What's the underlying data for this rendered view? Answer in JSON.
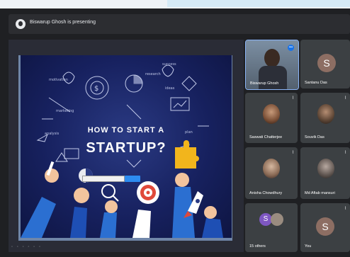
{
  "meeting": {
    "presenting_text": "Biswarup Ghosh is presenting"
  },
  "slide": {
    "title_line1": "HOW TO START A",
    "title_line2": "STARTUP?",
    "input_text": "",
    "button_text": ""
  },
  "participants": [
    {
      "name": "Biswarup Ghosh",
      "type": "video"
    },
    {
      "name": "Santanu Das",
      "type": "avatar",
      "initial": "S",
      "color": "#8d6e63"
    },
    {
      "name": "Saswati Chatterjee",
      "type": "photo"
    },
    {
      "name": "Souvik Das",
      "type": "photo"
    },
    {
      "name": "Anisha Chowdhury",
      "type": "photo"
    },
    {
      "name": "Md Aftab mansuri",
      "type": "photo"
    },
    {
      "name": "15 others",
      "type": "group",
      "initial": "S"
    },
    {
      "name": "You",
      "type": "avatar",
      "initial": "S",
      "color": "#8d6e63"
    }
  ],
  "colors": {
    "slide_bg": "#17215f",
    "accent_red": "#e0493a",
    "accent_yellow": "#f2b51c",
    "active_speaker_border": "#8ab4f8"
  },
  "icons": [
    "presenting-icon",
    "mic-muted-icon",
    "more-options-icon",
    "rocket-icon",
    "target-icon",
    "puzzle-icon",
    "lightbulb-icon"
  ]
}
